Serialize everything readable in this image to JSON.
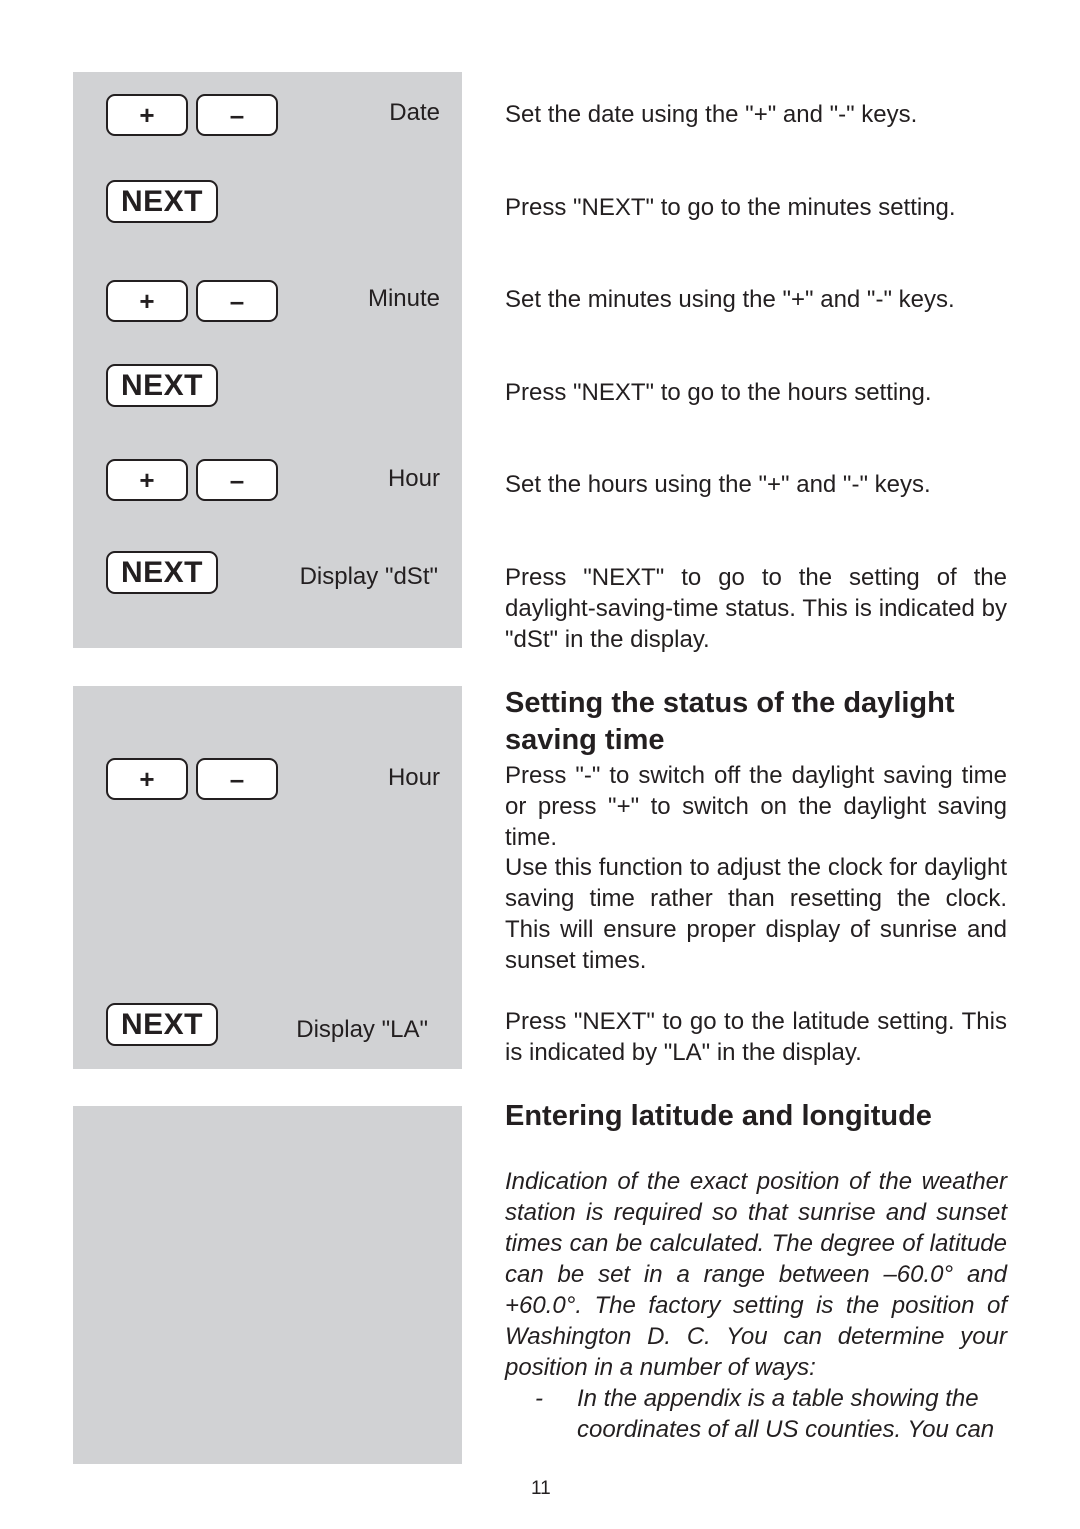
{
  "panels": [
    {
      "rows": [
        {
          "keys": [
            "+",
            "–"
          ],
          "label": "Date",
          "description": "Set the date using the \"+\" and \"-\" keys."
        },
        {
          "keys": [
            "NEXT"
          ],
          "label": "",
          "description": "Press \"NEXT\" to go to the minutes setting."
        },
        {
          "keys": [
            "+",
            "–"
          ],
          "label": "Minute",
          "description": "Set the minutes using the \"+\" and \"-\" keys."
        },
        {
          "keys": [
            "NEXT"
          ],
          "label": "",
          "description": "Press \"NEXT\" to go to the hours setting."
        },
        {
          "keys": [
            "+",
            "–"
          ],
          "label": "Hour",
          "description": "Set the hours using the \"+\" and \"-\" keys."
        },
        {
          "keys": [
            "NEXT"
          ],
          "label": "Display \"dSt\"",
          "description": "Press \"NEXT\" to go to the setting of the daylight-saving-time status. This is indicated by \"dSt\" in the display."
        }
      ]
    },
    {
      "heading": "Setting the status of the daylight saving time",
      "rows": [
        {
          "keys": [
            "+",
            "–"
          ],
          "label": "Hour",
          "description": "Press \"-\" to switch off the daylight saving time or press \"+\" to switch on the daylight saving time.",
          "description2": "Use this function to adjust the clock for daylight saving time rather than resetting the clock. This will ensure proper display of sunrise and sunset times."
        },
        {
          "keys": [
            "NEXT"
          ],
          "label": "Display \"LA\"",
          "description": "Press \"NEXT\" to go to the latitude setting. This is indicated by \"LA\" in the display."
        }
      ]
    },
    {
      "heading": "Entering latitude and longitude",
      "intro": "Indication of the exact position of the weather station is required so that sunrise and sunset times can be calculated. The degree of latitude can be set in a range between –60.0° and +60.0°. The factory setting is the position of Washington D. C. You can determine your position in a number of ways:",
      "bullets": [
        {
          "dash": "-",
          "text": "In the appendix is a table showing the coordinates of all US counties. You can"
        }
      ]
    }
  ],
  "page_number": "11",
  "colors": {
    "panel_bg": "#d1d2d4",
    "text": "#231f20",
    "key_bg": "#ffffff"
  }
}
